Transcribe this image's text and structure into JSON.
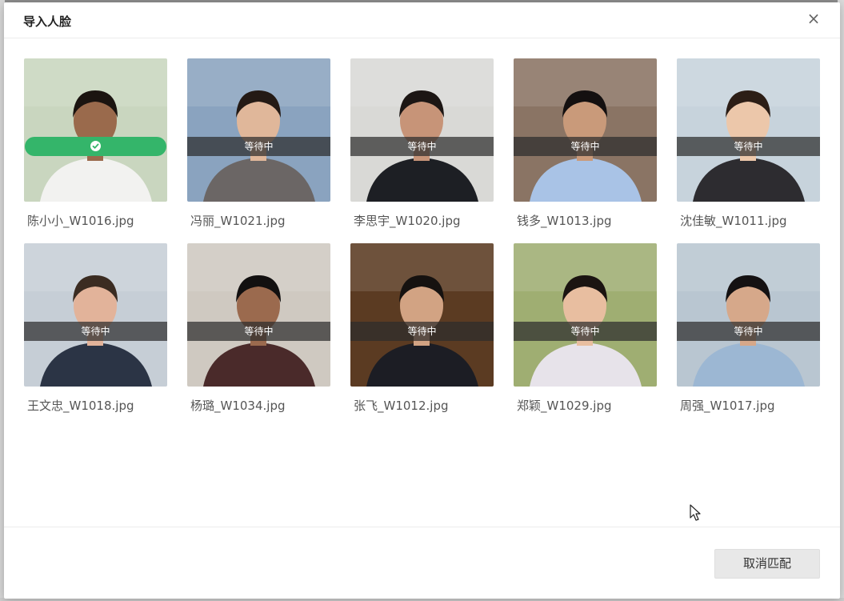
{
  "dialog": {
    "title": "导入人脸",
    "close_glyph": "×",
    "cancel_label": "取消匹配"
  },
  "photos": [
    {
      "file": "陈小小_W1016.jpg",
      "status": "",
      "done": true,
      "bg": "#c9d6bf",
      "skin": "#9a6a4c",
      "hair": "#1b1410",
      "cloth": "#f2f2f0"
    },
    {
      "file": "冯丽_W1021.jpg",
      "status": "等待中",
      "done": false,
      "bg": "#8aa3bf",
      "skin": "#e0b79a",
      "hair": "#241a15",
      "cloth": "#6b6665"
    },
    {
      "file": "李思宇_W1020.jpg",
      "status": "等待中",
      "done": false,
      "bg": "#d9d9d6",
      "skin": "#c79478",
      "hair": "#1c1614",
      "cloth": "#1d1f24"
    },
    {
      "file": "钱多_W1013.jpg",
      "status": "等待中",
      "done": false,
      "bg": "#8a7464",
      "skin": "#c99a7a",
      "hair": "#141010",
      "cloth": "#a9c3e6"
    },
    {
      "file": "沈佳敏_W1011.jpg",
      "status": "等待中",
      "done": false,
      "bg": "#c7d3dc",
      "skin": "#ecc7aa",
      "hair": "#2c1e16",
      "cloth": "#2d2c30"
    },
    {
      "file": "王文忠_W1018.jpg",
      "status": "等待中",
      "done": false,
      "bg": "#c6ced6",
      "skin": "#e2b39a",
      "hair": "#3b2c22",
      "cloth": "#2b3445"
    },
    {
      "file": "杨璐_W1034.jpg",
      "status": "等待中",
      "done": false,
      "bg": "#cfc9c1",
      "skin": "#9b6a4e",
      "hair": "#121010",
      "cloth": "#4a2a2a"
    },
    {
      "file": "张飞_W1012.jpg",
      "status": "等待中",
      "done": false,
      "bg": "#5b3b22",
      "skin": "#d2a383",
      "hair": "#161210",
      "cloth": "#1c1d24"
    },
    {
      "file": "郑颖_W1029.jpg",
      "status": "等待中",
      "done": false,
      "bg": "#9fae72",
      "skin": "#e8bea0",
      "hair": "#1b1411",
      "cloth": "#e7e3ea"
    },
    {
      "file": "周强_W1017.jpg",
      "status": "等待中",
      "done": false,
      "bg": "#b9c6d1",
      "skin": "#d6a88a",
      "hair": "#141112",
      "cloth": "#9cb7d3"
    }
  ]
}
